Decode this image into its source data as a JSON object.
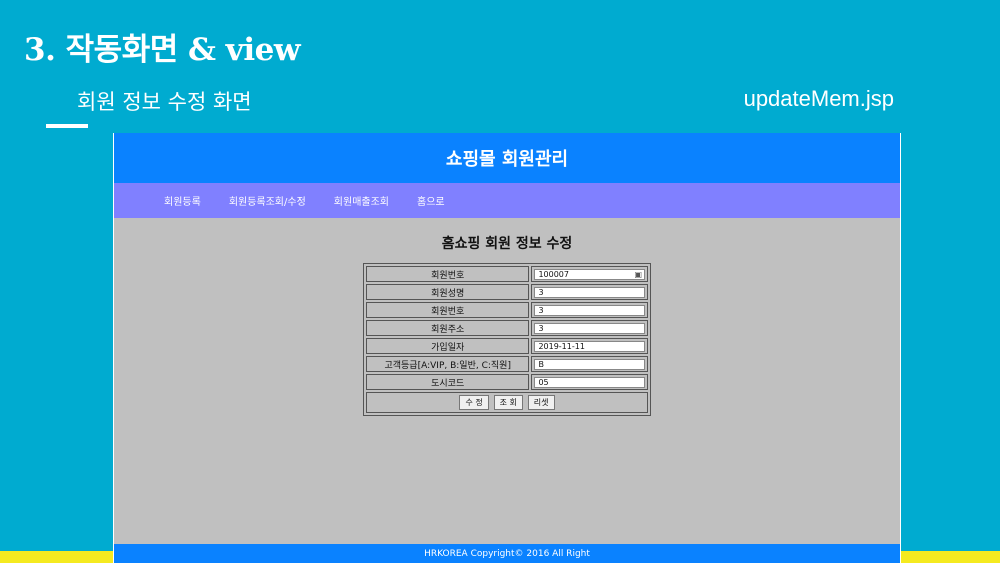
{
  "slide": {
    "title": "3. 작동화면 & view",
    "subtitle": "회원 정보 수정 화면",
    "filename": "updateMem.jsp"
  },
  "app": {
    "header_title": "쇼핑몰 회원관리",
    "nav": [
      {
        "label": "회원등록"
      },
      {
        "label": "회원등록조회/수정"
      },
      {
        "label": "회원매출조회"
      },
      {
        "label": "홈으로"
      }
    ],
    "form_title": "홈쇼핑 회원 정보 수정",
    "fields": [
      {
        "label": "회원번호",
        "value": "100007"
      },
      {
        "label": "회원성명",
        "value": "3"
      },
      {
        "label": "회원번호",
        "value": "3"
      },
      {
        "label": "회원주소",
        "value": "3"
      },
      {
        "label": "가입일자",
        "value": "2019-11-11"
      },
      {
        "label": "고객등급[A:VIP, B:일반, C:직원]",
        "value": "B"
      },
      {
        "label": "도시코드",
        "value": "05"
      }
    ],
    "buttons": {
      "update": "수 정",
      "query": "조 회",
      "reset": "리셋"
    },
    "footer": "HRKOREA Copyright© 2016 All Right"
  },
  "colors": {
    "slide_bg": "#00abd0",
    "header_bg": "#0a82ff",
    "nav_bg": "#8080ff",
    "content_bg": "#c0c0c0",
    "bottom_band": "#f5ea20"
  }
}
